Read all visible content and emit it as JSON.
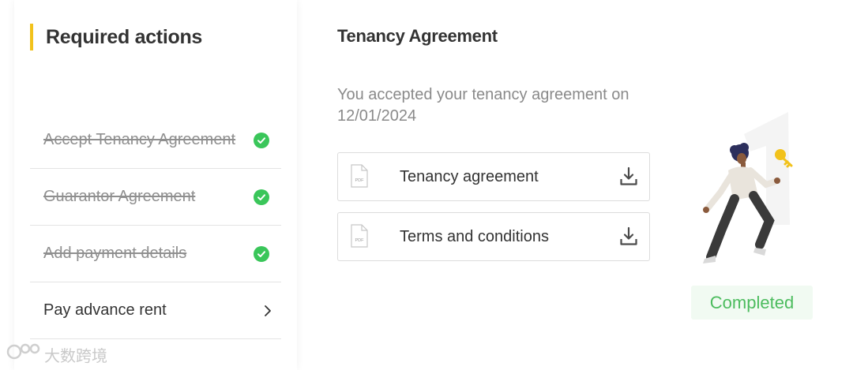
{
  "sidebar": {
    "title": "Required actions",
    "items": [
      {
        "label": "Accept Tenancy Agreement",
        "status": "completed"
      },
      {
        "label": "Guarantor Agreement",
        "status": "completed"
      },
      {
        "label": "Add payment details",
        "status": "completed"
      },
      {
        "label": "Pay advance rent",
        "status": "pending"
      }
    ]
  },
  "main": {
    "title": "Tenancy Agreement",
    "accepted_text": "You accepted your tenancy agreement on 12/01/2024",
    "documents": [
      {
        "name": "Tenancy agreement",
        "icon": "pdf-file-icon",
        "action_icon": "download-icon"
      },
      {
        "name": "Terms and conditions",
        "icon": "pdf-file-icon",
        "action_icon": "download-icon"
      }
    ],
    "pdf_icon_text": "PDF",
    "status_badge": "Completed"
  },
  "watermark": {
    "text": "大数跨境"
  },
  "colors": {
    "accent": "#f2c21b",
    "success": "#3ac65a",
    "badge_text": "#4cbc5e",
    "badge_bg": "#f1faf2"
  }
}
